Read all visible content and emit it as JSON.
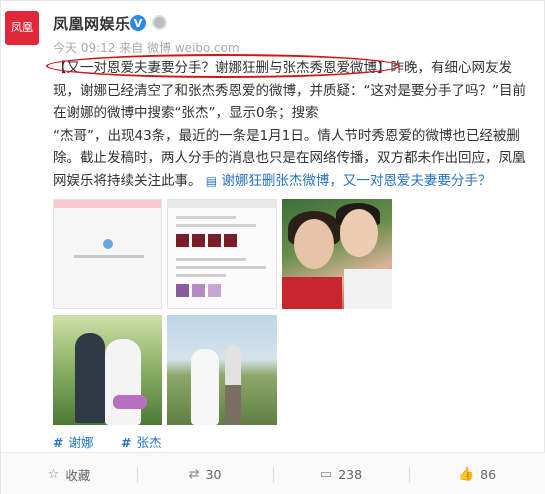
{
  "post": {
    "avatar_text": "凤凰",
    "username": "凤凰网娱乐",
    "verified_mark": "V",
    "meta_line": "今天 09:12 来自 微博 weibo.com",
    "content_lines": {
      "l1_headline": "【又一对恩爱夫妻要分手？谢娜狂删与张杰秀恩爱微博】",
      "l1_rest": "昨晚，有细心网友发",
      "l2": "现，谢娜已经清空了和张杰秀恩爱的微博，并质疑：“这对是要分手了吗？”目前",
      "l3": "在谢娜的微博中搜索“张杰”，显示0条；搜索",
      "l4": "“杰哥”，出现43条，最近的一条是1月1日。情人节时秀恩爱的微博也已经被删",
      "l5": "除。截止发稿时，两人分手的消息也只是在网络传播，双方都未作出回应，凤凰",
      "l6_text": "网娱乐将持续关注此事。",
      "l6_link": "谢娜狂删张杰微博，又一对恩爱夫妻要分手？"
    },
    "topics": [
      "谢娜",
      "张杰"
    ]
  },
  "footer": {
    "favorite_label": "收藏",
    "repost_count": "30",
    "comment_count": "238",
    "like_count": "86"
  },
  "colors": {
    "brand_red": "#e0283a",
    "link_blue": "#2773c7",
    "highlight_oval": "#d21414"
  },
  "icons": [
    "star-icon",
    "repost-icon",
    "comment-icon",
    "thumbs-up-icon",
    "verified-icon",
    "link-icon",
    "hash-icon"
  ]
}
